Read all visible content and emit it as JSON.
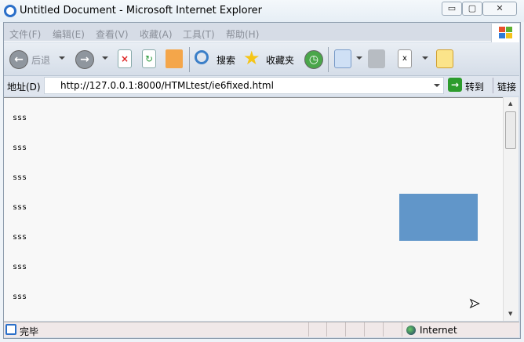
{
  "window": {
    "title": "Untitled Document - Microsoft Internet Explorer",
    "minimize": "▭",
    "restore": "▢",
    "close": "✕"
  },
  "menu": [
    "文件(F)",
    "编辑(E)",
    "查看(V)",
    "收藏(A)",
    "工具(T)",
    "帮助(H)"
  ],
  "toolbar": {
    "back": "后退",
    "search": "搜索",
    "favorites": "收藏夹"
  },
  "address": {
    "label": "地址(D)",
    "url": "http://127.0.0.1:8000/HTMLtest/ie6fixed.html",
    "go": "转到",
    "links": "链接"
  },
  "content": {
    "lines": [
      "sss",
      "sss",
      "sss",
      "sss",
      "sss",
      "sss",
      "sss"
    ],
    "box_color": "#6196c9"
  },
  "status": {
    "text": "完毕",
    "zone": "Internet"
  }
}
